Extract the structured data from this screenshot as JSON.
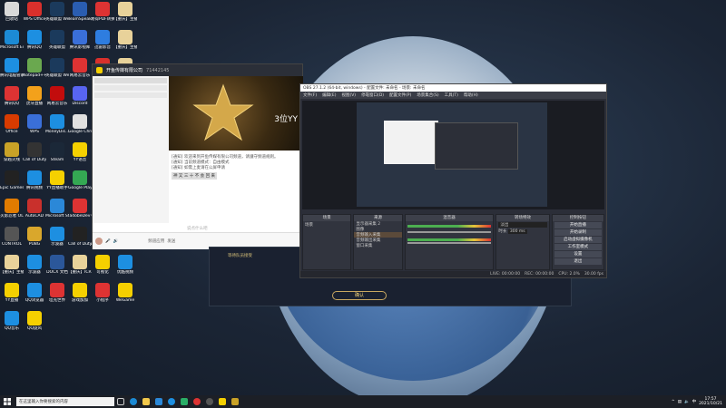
{
  "desktop_icons": [
    {
      "label": "回收站",
      "color": "#d9d9d9"
    },
    {
      "label": "WPS Office",
      "color": "#d9302c"
    },
    {
      "label": "英雄联盟 WeGame版",
      "color": "#1b3a5c"
    },
    {
      "label": "TeamSpeak 3 Client",
      "color": "#2a5db0"
    },
    {
      "label": "易得PDF转换器",
      "color": "#d33"
    },
    {
      "label": "【重庆】主播 的设置",
      "color": "#e8d29a"
    },
    {
      "label": "Microsoft Edge",
      "color": "#1c8ad4"
    },
    {
      "label": "腾讯QQ",
      "color": "#1d8fe1"
    },
    {
      "label": "英雄联盟",
      "color": "#1b3a5c"
    },
    {
      "label": "腾讯影视库",
      "color": "#3a6fd8"
    },
    {
      "label": "迅雷影音",
      "color": "#2e7de0"
    },
    {
      "label": "【重庆】主播 小组",
      "color": "#e8d29a"
    },
    {
      "label": "腾讯电脑管家",
      "color": "#1d8fe1"
    },
    {
      "label": "Notepad++",
      "color": "#6aa84f"
    },
    {
      "label": "英雄联盟 WeGame版",
      "color": "#1b3a5c"
    },
    {
      "label": "网易云音乐",
      "color": "#d33"
    },
    {
      "label": "WPS Office",
      "color": "#d9302c"
    },
    {
      "label": "【重庆】主播 2.0",
      "color": "#e8d29a"
    },
    {
      "label": "腾讯QQ",
      "color": "#d33"
    },
    {
      "label": "虎牙直播",
      "color": "#f3a11b"
    },
    {
      "label": "网易云音乐",
      "color": "#c20c0c"
    },
    {
      "label": "Discord",
      "color": "#5865f2"
    },
    {
      "label": "QQ音乐",
      "color": "#31c27c"
    },
    {
      "label": "GoodSync",
      "color": "#1d6fd8"
    },
    {
      "label": "Office",
      "color": "#d83b01"
    },
    {
      "label": "WPS",
      "color": "#3a6fd8"
    },
    {
      "label": "MoneyDis...",
      "color": "#1d8fe1"
    },
    {
      "label": "Google Chrome",
      "color": "#e0e0e0"
    },
    {
      "label": "WeGame",
      "color": "#d33"
    },
    {
      "label": "我的世界",
      "color": "#7a9a3a"
    },
    {
      "label": "穿越火线",
      "color": "#c9a227"
    },
    {
      "label": "Call of Duty Black Ops",
      "color": "#333"
    },
    {
      "label": "Steam",
      "color": "#1b2838"
    },
    {
      "label": "YY语音",
      "color": "#f5d000"
    },
    {
      "label": "我的游戏",
      "color": "#5b8cff"
    },
    {
      "label": "QQ游戏",
      "color": "#d33"
    },
    {
      "label": "Epic Games",
      "color": "#222"
    },
    {
      "label": "腾讯视频",
      "color": "#1d8fe1"
    },
    {
      "label": "YY直播助手",
      "color": "#f5d000"
    },
    {
      "label": "Google Play 服务",
      "color": "#34a853"
    },
    {
      "label": "UU加速器",
      "color": "#1d8fe1"
    },
    {
      "label": "HELIX.D...",
      "color": "#333"
    },
    {
      "label": "火影忍者 OL",
      "color": "#e07b00"
    },
    {
      "label": "AutoCAD",
      "color": "#c9302c"
    },
    {
      "label": "Microsoft Store",
      "color": "#2b88d8"
    },
    {
      "label": "adobeDev",
      "color": "#d33"
    },
    {
      "label": "OBS Studio",
      "color": "#302e31"
    },
    {
      "label": "autodesk 360",
      "color": "#1d8fe1"
    },
    {
      "label": "CONTROL",
      "color": "#555"
    },
    {
      "label": "PUBG",
      "color": "#d9a72c"
    },
    {
      "label": "示波器",
      "color": "#1d8fe1"
    },
    {
      "label": "Call of Duty Modern...",
      "color": "#222"
    },
    {
      "label": "autodesk FaCal",
      "color": "#1d8fe1"
    },
    {
      "label": "Realtek",
      "color": "#1d8fe1"
    },
    {
      "label": "【重庆】主播 文档",
      "color": "#e8d29a"
    },
    {
      "label": "示波器",
      "color": "#1d8fe1"
    },
    {
      "label": "DOCX 文档",
      "color": "#2b579a"
    },
    {
      "label": "【重庆】ICR 工作记录",
      "color": "#e8d29a"
    },
    {
      "label": "可视化",
      "color": "#f5d000"
    },
    {
      "label": "优酷视频",
      "color": "#1d8fe1"
    },
    {
      "label": "YY直播",
      "color": "#f5d000"
    },
    {
      "label": "QQ浏览器",
      "color": "#1d8fe1"
    },
    {
      "label": "坦克世界",
      "color": "#d33"
    },
    {
      "label": "游戏加加",
      "color": "#f5d000"
    },
    {
      "label": "小程序",
      "color": "#d33"
    },
    {
      "label": "WeGame",
      "color": "#f5d000"
    },
    {
      "label": "QQ音乐",
      "color": "#1d8fe1"
    },
    {
      "label": "QQ旋风",
      "color": "#f5d000"
    }
  ],
  "yy_window": {
    "title": "开鱼传媒有限公司",
    "channel_id": "71442145",
    "banner_text": "3位YY",
    "chat_lines": [
      "[通知] 欢迎来到开鱼传媒有限公司频道，请遵守频道规则。",
      "[通知] 当前频道模式：自由模式",
      "[通知] 如需上麦请在公屏申请"
    ],
    "chat_highlight": "神 又 三 十 不 会 回 来",
    "input_placeholder": "说点什么吧",
    "bottom_labels": [
      "频道应用",
      "发送"
    ]
  },
  "obs": {
    "title": "OBS 27.1.2 (64-bit, windows) - 配置文件: 未命名 - 场景: 未命名",
    "menu": [
      "文件(F)",
      "编辑(E)",
      "视图(V)",
      "停靠窗口(D)",
      "配置文件(P)",
      "场景集合(S)",
      "工具(T)",
      "帮助(H)"
    ],
    "docks": {
      "scenes": "场景",
      "sources": "来源",
      "mixer": "混音器",
      "transitions": "转场特效",
      "controls": "控制按钮"
    },
    "scene_item": "场景",
    "sources_list": [
      "显示器采集 2",
      "图像",
      "音频输入采集",
      "音频输出采集",
      "窗口采集"
    ],
    "transition_labels": [
      "淡出",
      "时长",
      "300 ms"
    ],
    "control_buttons": [
      "开始直播",
      "开始录制",
      "启动虚拟摄像机",
      "工作室模式",
      "设置",
      "退出"
    ],
    "status": [
      "LIVE: 00:00:00",
      "REC: 00:00:00",
      "CPU: 2.0%",
      "30.00 fps"
    ]
  },
  "game_overlay": {
    "text": "确认",
    "hint": "等待队员接受"
  },
  "taskbar": {
    "search_placeholder": "在这里输入你要搜索的内容",
    "time": "17:57",
    "date": "2021/10/21",
    "lang": "中"
  }
}
